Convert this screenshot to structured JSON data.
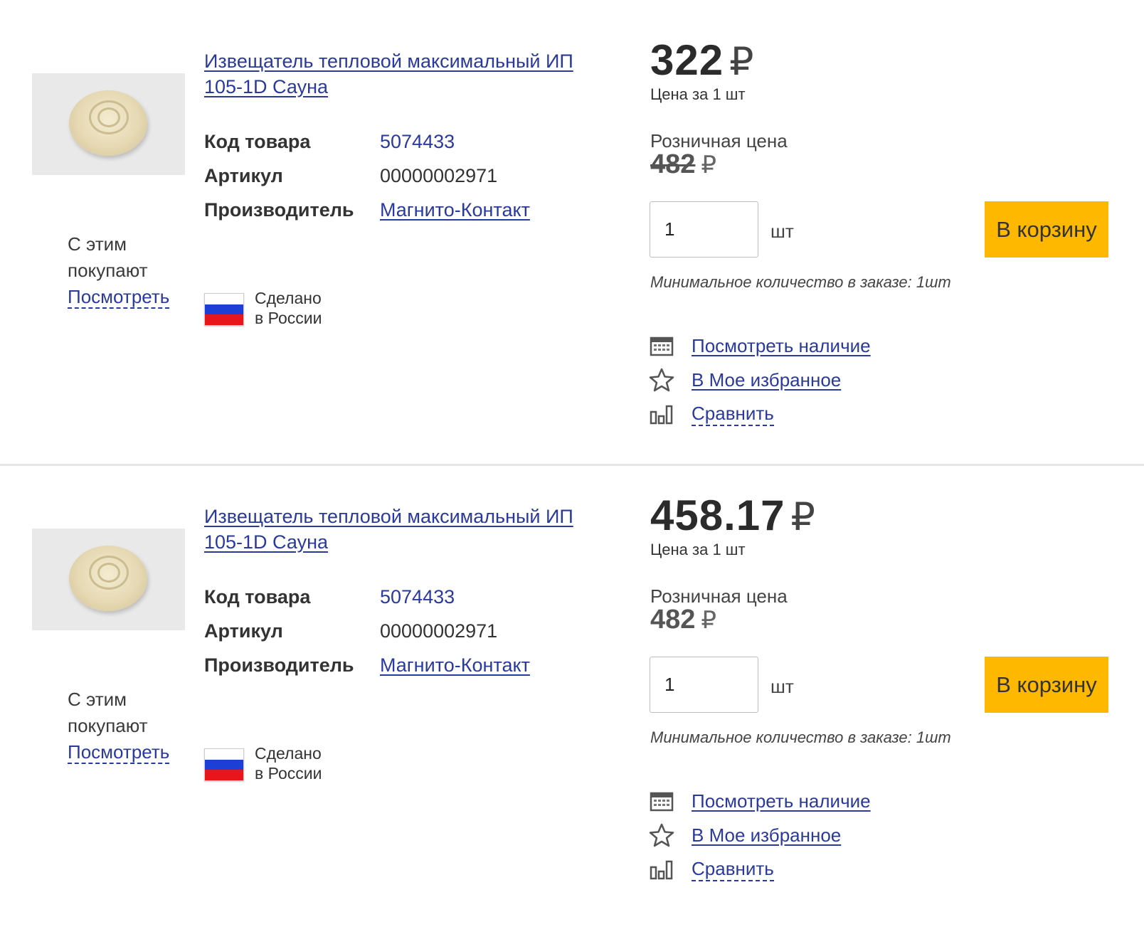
{
  "products": [
    {
      "title": "Извещатель тепловой максимальный ИП 105-1D Сауна",
      "also_buy": {
        "line1": "С этим",
        "line2": "покупают",
        "link": "Посмотреть"
      },
      "specs": {
        "code_label": "Код товара",
        "code": "5074433",
        "article_label": "Артикул",
        "article": "00000002971",
        "maker_label": "Производитель",
        "maker": "Магнито-Контакт"
      },
      "made_in": {
        "line1": "Сделано",
        "line2": "в России"
      },
      "price": "322",
      "currency": "₽",
      "per_unit": "Цена за 1 шт",
      "retail_label": "Розничная цена",
      "retail_price": "482",
      "retail_struck": true,
      "quantity": "1",
      "unit": "шт",
      "cart_label": "В корзину",
      "min_order": "Минимальное количество в заказе: 1шт",
      "actions": {
        "availability": "Посмотреть наличие",
        "favorites": "В Мое избранное",
        "compare": "Сравнить"
      }
    },
    {
      "title": "Извещатель тепловой максимальный ИП 105-1D Сауна",
      "also_buy": {
        "line1": "С этим",
        "line2": "покупают",
        "link": "Посмотреть"
      },
      "specs": {
        "code_label": "Код товара",
        "code": "5074433",
        "article_label": "Артикул",
        "article": "00000002971",
        "maker_label": "Производитель",
        "maker": "Магнито-Контакт"
      },
      "made_in": {
        "line1": "Сделано",
        "line2": "в России"
      },
      "price": "458.17",
      "currency": "₽",
      "per_unit": "Цена за 1 шт",
      "retail_label": "Розничная цена",
      "retail_price": "482",
      "retail_struck": false,
      "quantity": "1",
      "unit": "шт",
      "cart_label": "В корзину",
      "min_order": "Минимальное количество в заказе: 1шт",
      "actions": {
        "availability": "Посмотреть наличие",
        "favorites": "В Мое избранное",
        "compare": "Сравнить"
      }
    }
  ],
  "colors": {
    "link": "#2a3a9c",
    "cart_button": "#ffb800",
    "divider": "#e6e6e6"
  },
  "icons": {
    "availability": "calendar-icon",
    "favorites": "star-icon",
    "compare": "bar-chart-icon"
  }
}
